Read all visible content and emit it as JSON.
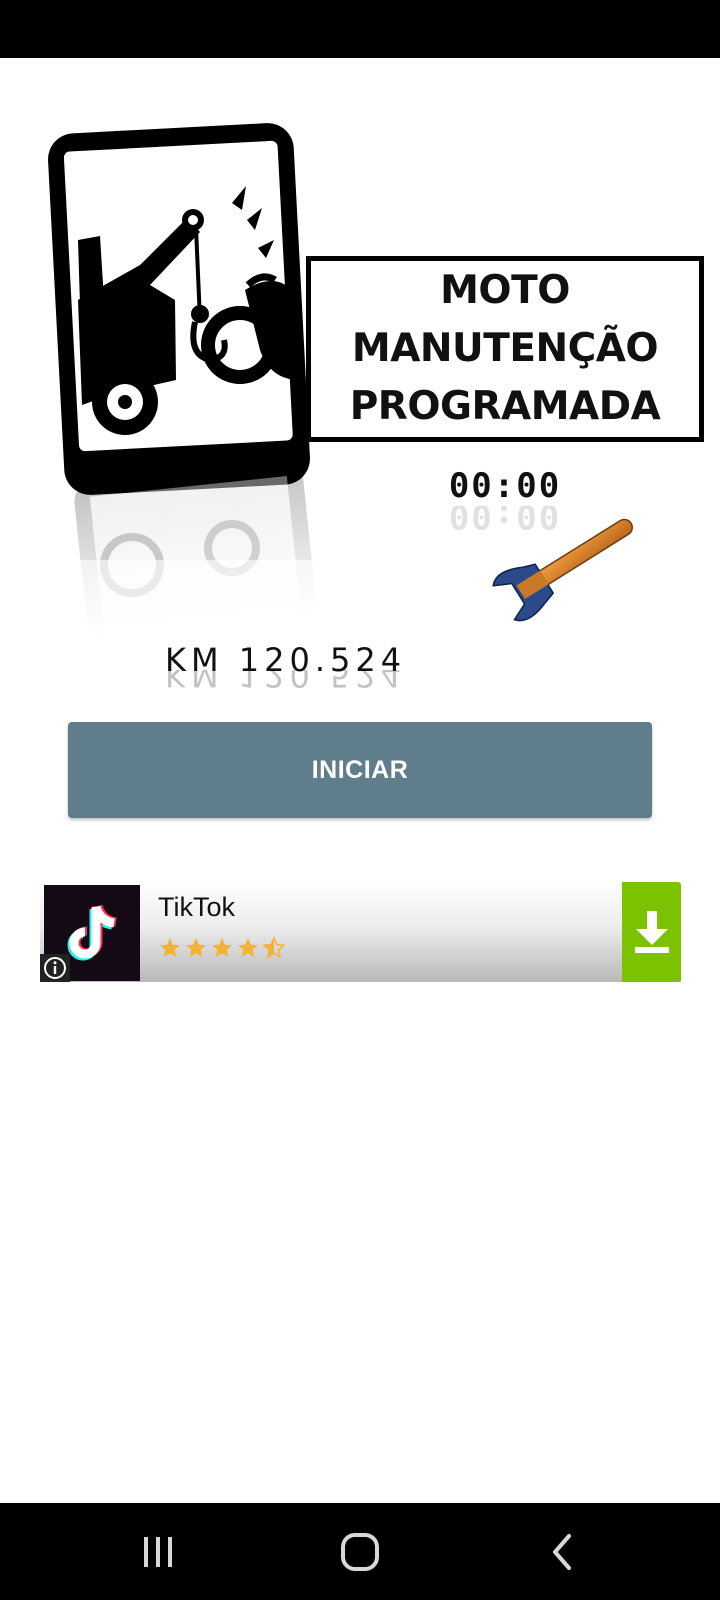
{
  "app": {
    "title_lines": [
      "MOTO",
      "MANUTENÇÃO",
      "PROGRAMADA"
    ],
    "timer": "00:00",
    "odometer": "KM 120.524",
    "start_button": "INICIAR"
  },
  "ad": {
    "app_name": "TikTok",
    "rating": 4.5,
    "icon": "tiktok-logo",
    "info_icon": "info-icon",
    "download_icon": "download-icon",
    "colors": {
      "download_bg": "#7cc200",
      "star": "#f5b335"
    }
  },
  "colors": {
    "button": "#607d8b",
    "button_text": "#ffffff"
  },
  "navigation": {
    "icons": [
      "recent-apps-icon",
      "home-icon",
      "back-icon"
    ]
  }
}
